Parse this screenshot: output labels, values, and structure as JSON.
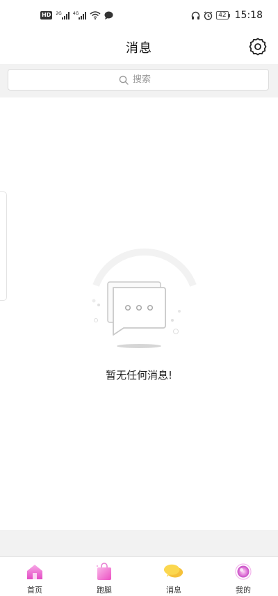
{
  "status_bar": {
    "network_left": "HD",
    "sim1": "2G",
    "sim2": "4G",
    "battery": "42",
    "time": "15:18"
  },
  "header": {
    "title": "消息"
  },
  "search": {
    "placeholder": "搜索"
  },
  "empty_state": {
    "message": "暂无任何消息!"
  },
  "tab_bar": {
    "items": [
      {
        "label": "首页",
        "icon": "home-icon"
      },
      {
        "label": "跑腿",
        "icon": "shopping-bag-icon"
      },
      {
        "label": "消息",
        "icon": "message-bubbles-icon"
      },
      {
        "label": "我的",
        "icon": "profile-icon"
      }
    ]
  },
  "colors": {
    "home": "#e85bc9",
    "bag": "#f067c7",
    "message_active": "#f7c51e",
    "profile": "#d865d6",
    "background_gray": "#f2f2f2"
  }
}
